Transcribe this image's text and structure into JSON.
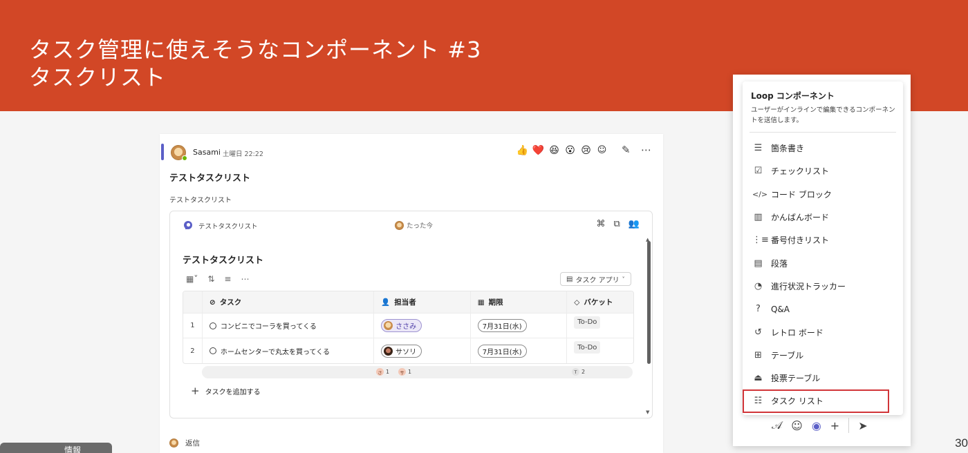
{
  "slide": {
    "title_line1": "タスク管理に使えそうなコンポーネント #3",
    "title_line2": "タスクリスト",
    "page_number": "30",
    "corner_tab_label": "情報"
  },
  "message": {
    "sender": "Sasami",
    "time": "土曜日 22:22",
    "subject": "テストタスクリスト",
    "body": "テストタスクリスト",
    "reply_label": "返信"
  },
  "loop_card": {
    "name": "テストタスクリスト",
    "edited": "たった今",
    "list_title": "テストタスクリスト",
    "app_button": "タスク アプリ",
    "columns": [
      "タスク",
      "担当者",
      "期限",
      "バケット"
    ],
    "rows": [
      {
        "num": "1",
        "task": "コンビニでコーラを買ってくる",
        "assignee": "ささみ",
        "due": "7月31日(水)",
        "bucket": "To-Do"
      },
      {
        "num": "2",
        "task": "ホームセンターで丸太を買ってくる",
        "assignee": "サソリ",
        "due": "7月31日(水)",
        "bucket": "To-Do"
      }
    ],
    "summary": {
      "assignee1_letter": "さ",
      "assignee1_count": "1",
      "assignee2_letter": "サ",
      "assignee2_count": "1",
      "bucket_letter": "T",
      "bucket_count": "2"
    },
    "add_task": "タスクを追加する"
  },
  "menu": {
    "title": "Loop コンポーネント",
    "description": "ユーザーがインラインで編集できるコンポーネントを送信します。",
    "items": [
      {
        "label": "箇条書き",
        "icon": "bulleted-list-icon"
      },
      {
        "label": "チェックリスト",
        "icon": "checklist-icon"
      },
      {
        "label": "コード ブロック",
        "icon": "code-icon"
      },
      {
        "label": "かんばんボード",
        "icon": "kanban-icon"
      },
      {
        "label": "番号付きリスト",
        "icon": "numbered-list-icon"
      },
      {
        "label": "段落",
        "icon": "paragraph-icon"
      },
      {
        "label": "進行状況トラッカー",
        "icon": "progress-tracker-icon"
      },
      {
        "label": "Q&A",
        "icon": "qa-icon"
      },
      {
        "label": "レトロ ボード",
        "icon": "retro-board-icon"
      },
      {
        "label": "テーブル",
        "icon": "table-icon"
      },
      {
        "label": "投票テーブル",
        "icon": "voting-table-icon"
      },
      {
        "label": "タスク リスト",
        "icon": "task-list-icon"
      }
    ]
  },
  "colors": {
    "slide_header": "#d24726",
    "accent": "#5b5fc7",
    "selection_outline": "#d13438"
  }
}
